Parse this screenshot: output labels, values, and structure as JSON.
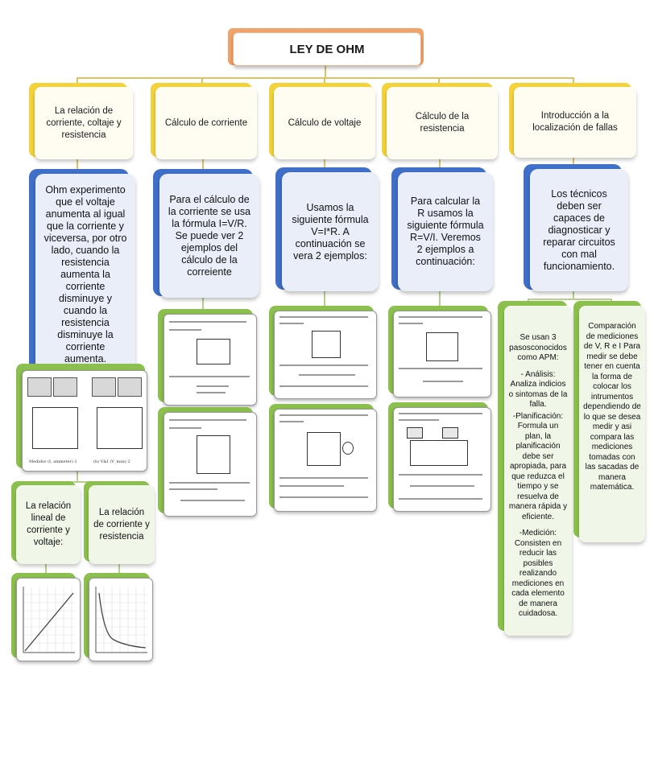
{
  "title": "LEY DE OHM",
  "topics": [
    {
      "label": "La relación de corriente, coltaje y resistencia"
    },
    {
      "label": "Cálculo de corriente"
    },
    {
      "label": "Cálculo de voltaje"
    },
    {
      "label": "Cálculo de la resistencia"
    },
    {
      "label": "Introducción a la localización de fallas"
    }
  ],
  "details": [
    {
      "text": "Ohm experimento que el voltaje anumenta al igual que la corriente y viceversa, por otro lado, cuando la resistencia aumenta la corriente disminuye y cuando la resistencia disminuye la corriente aumenta."
    },
    {
      "text": "Para el cálculo de la corriente se usa la fórmula I=V/R.\nSe puede ver 2 ejemplos del cálculo de la correiente"
    },
    {
      "text": "Usamos la siguiente fórmula V=I*R. A continuación se vera 2 ejemplos:"
    },
    {
      "text": "Para calcular la R usamos la siguiente fórmula R=V/I. Veremos 2 ejemplos a continuación:"
    },
    {
      "text": "Los técnicos deben ser capaces de diagnosticar y reparar circuitos con mal funcionamiento."
    }
  ],
  "sub_relation": [
    {
      "label": "La relación lineal de corriente y voltaje:"
    },
    {
      "label": "La relación de corriente y resistencia"
    }
  ],
  "apm": {
    "intro": "Se usan 3 pasosconocidos como APM:",
    "analisis": "- Análisis: Analiza indicios o sintomas de la falla.",
    "planificacion": "-Planificación: Formula un plan, la planificación debe ser apropiada, para que reduzca el tiempo y se resuelva de manera rápida y eficiente.",
    "medicion": "-Medición: Consisten en reducir las posibles realizando mediciones en cada elemento de manera cuidadosa."
  },
  "comparacion": "Comparación de mediciones de V, R e I Para medir se debe tener en cuenta la forma de colocar los intrumentos dependiendo de lo que se desea medir y asi compara las mediciones tomadas con las sacadas de manera matemática.",
  "colors": {
    "title_accent": "#f2a36a",
    "topic_accent": "#f4d23a",
    "detail_accent": "#3f6fc8",
    "example_accent": "#8cc04e"
  }
}
